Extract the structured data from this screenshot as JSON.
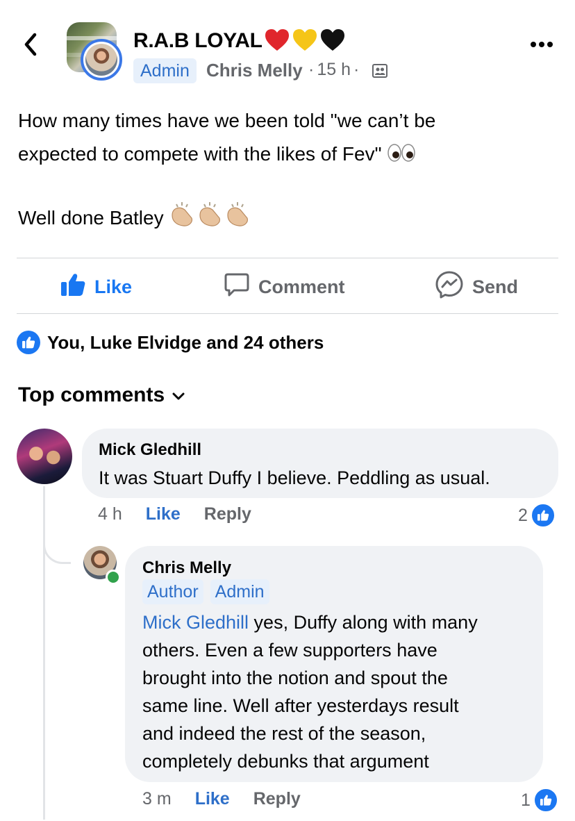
{
  "header": {
    "group_name": "R.A.B LOYAL",
    "heart_colors": [
      "#e0262c",
      "#f5c518",
      "#111111"
    ],
    "admin_badge": "Admin",
    "author": "Chris Melly",
    "time": "15 h",
    "separator": "·",
    "icons": [
      "back-icon",
      "more-icon",
      "group-audience-icon"
    ]
  },
  "post": {
    "line1": "How many times have we been told \"we can’t be",
    "line2": "expected to compete with the likes of Fev\"",
    "line3": "Well done Batley",
    "emoji": [
      "eyes-emoji",
      "clapping-hands-emoji"
    ]
  },
  "actions": {
    "like": "Like",
    "comment": "Comment",
    "send": "Send"
  },
  "reactions": {
    "summary": "You, Luke Elvidge and 24 others"
  },
  "comments_header": {
    "label": "Top comments"
  },
  "comments": [
    {
      "name": "Mick Gledhill",
      "text": "It was Stuart Duffy I believe. Peddling as usual.",
      "time": "4 h",
      "like": "Like",
      "reply": "Reply",
      "like_count": "2"
    },
    {
      "name": "Chris Melly",
      "badges": [
        "Author",
        "Admin"
      ],
      "mention": "Mick Gledhill",
      "text_lines": [
        " yes, Duffy along with many",
        "others. Even a few supporters have",
        "brought into the notion and spout the",
        "same line. Well after yesterdays result",
        "and indeed the rest of the season,",
        "completely debunks that argument"
      ],
      "time": "3 m",
      "like": "Like",
      "reply": "Reply",
      "like_count": "1",
      "online": true
    }
  ],
  "colors": {
    "accent": "#1877f2",
    "link": "#2e6fc9",
    "muted": "#65676b",
    "bubble": "#f0f2f5"
  }
}
